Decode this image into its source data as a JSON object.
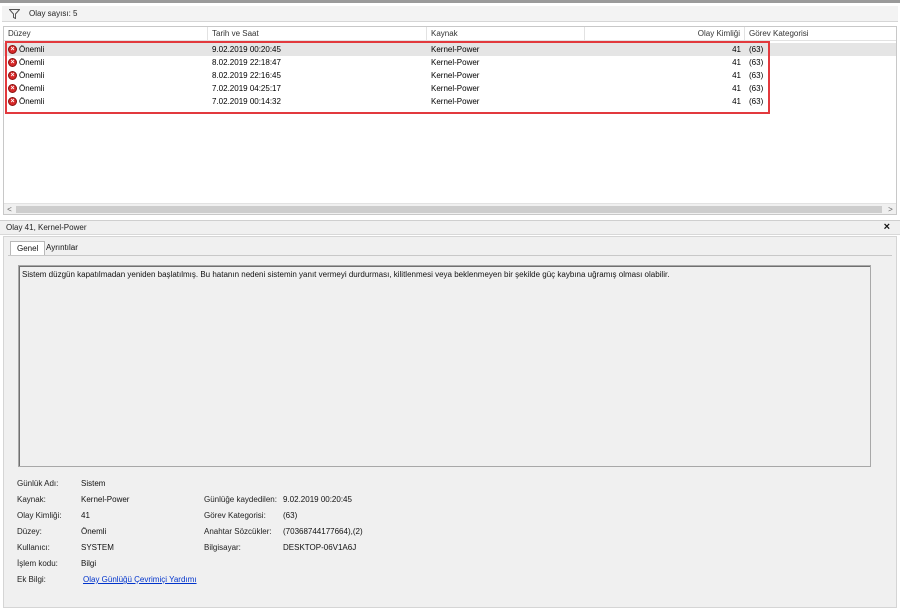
{
  "toolbar": {
    "filter_icon": "filter-icon",
    "event_count_label": "Olay sayısı: 5"
  },
  "columns": {
    "level": "Düzey",
    "date_time": "Tarih ve Saat",
    "source": "Kaynak",
    "event_id": "Olay Kimliği",
    "task_category": "Görev Kategorisi"
  },
  "events": [
    {
      "level": "Önemli",
      "date_time": "9.02.2019 00:20:45",
      "source": "Kernel-Power",
      "event_id": "41",
      "task_category": "(63)"
    },
    {
      "level": "Önemli",
      "date_time": "8.02.2019 22:18:47",
      "source": "Kernel-Power",
      "event_id": "41",
      "task_category": "(63)"
    },
    {
      "level": "Önemli",
      "date_time": "8.02.2019 22:16:45",
      "source": "Kernel-Power",
      "event_id": "41",
      "task_category": "(63)"
    },
    {
      "level": "Önemli",
      "date_time": "7.02.2019 04:25:17",
      "source": "Kernel-Power",
      "event_id": "41",
      "task_category": "(63)"
    },
    {
      "level": "Önemli",
      "date_time": "7.02.2019 00:14:32",
      "source": "Kernel-Power",
      "event_id": "41",
      "task_category": "(63)"
    }
  ],
  "scroll": {
    "left_arrow": "<",
    "right_arrow": ">"
  },
  "details": {
    "title": "Olay 41, Kernel-Power",
    "close_glyph": "×",
    "tabs": [
      "Genel",
      "Ayrıntılar"
    ],
    "description": "Sistem düzgün kapatılmadan yeniden başlatılmış. Bu hatanın nedeni sistemin yanıt vermeyi durdurması, kilitlenmesi veya beklenmeyen bir şekilde güç kaybına uğramış olması olabilir.",
    "labels": {
      "log_name": "Günlük Adı:",
      "source": "Kaynak:",
      "event_id": "Olay Kimliği:",
      "level": "Düzey:",
      "user": "Kullanıcı:",
      "opcode": "İşlem kodu:",
      "more_info": "Ek Bilgi:",
      "logged": "Günlüğe kaydedilen:",
      "task_category": "Görev Kategorisi:",
      "keywords": "Anahtar Sözcükler:",
      "computer": "Bilgisayar:"
    },
    "values": {
      "log_name": "Sistem",
      "source": "Kernel-Power",
      "event_id": "41",
      "level": "Önemli",
      "user": "SYSTEM",
      "opcode": "Bilgi",
      "more_info_link": "Olay Günlüğü Çevrimiçi Yardımı",
      "logged": "9.02.2019 00:20:45",
      "task_category": "(63)",
      "keywords": "(70368744177664),(2)",
      "computer": "DESKTOP-06V1A6J"
    }
  },
  "colors": {
    "error_red": "#d62828",
    "highlight_box": "#e2393d",
    "link_blue": "#0033cc",
    "selected_row": "#e5e5e5"
  }
}
